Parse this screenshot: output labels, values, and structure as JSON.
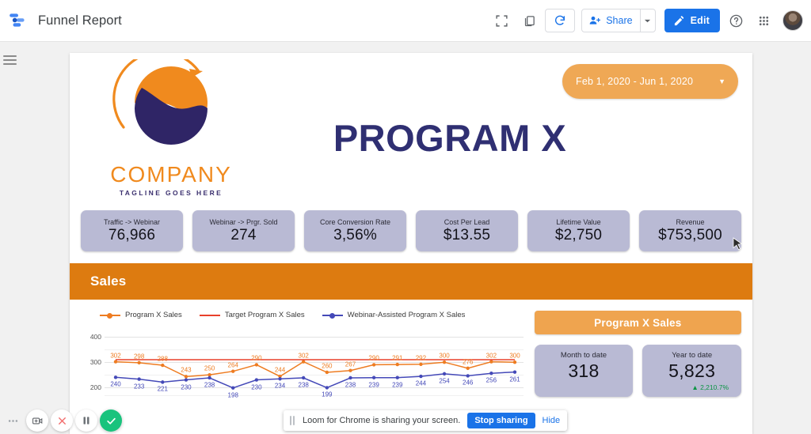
{
  "topbar": {
    "doc_title": "Funnel Report",
    "logo_icon": "data-studio-icon",
    "fullscreen_icon": "fullscreen-icon",
    "copy_icon": "copy-icon",
    "refresh_icon": "refresh-icon",
    "share_label": "Share",
    "share_icon": "person-add-icon",
    "share_caret_icon": "chevron-down-icon",
    "edit_label": "Edit",
    "edit_icon": "pencil-icon",
    "help_icon": "help-circle-icon",
    "apps_icon": "apps-grid-icon",
    "avatar_name": "user-avatar"
  },
  "rail": {
    "menu_icon": "hamburger-menu-icon"
  },
  "report": {
    "logo": {
      "company": "COMPANY",
      "tagline": "TAGLINE GOES HERE",
      "orange": "#F08A1E",
      "navy": "#3a2f6e"
    },
    "title": "PROGRAM X",
    "date_range": {
      "value": "Feb 1, 2020 - Jun 1, 2020",
      "caret_icon": "chevron-down-icon",
      "color": "#EFA855"
    },
    "kpis": [
      {
        "label": "Traffic -> Webinar",
        "value": "76,966"
      },
      {
        "label": "Webinar -> Prgr. Sold",
        "value": "274"
      },
      {
        "label": "Core Conversion Rate",
        "value": "3,56%"
      },
      {
        "label": "Cost Per Lead",
        "value": "$13.55"
      },
      {
        "label": "Lifetime Value",
        "value": "$2,750"
      },
      {
        "label": "Revenue",
        "value": "$753,500"
      }
    ],
    "section_banner": {
      "label": "Sales",
      "color": "#DD7B10"
    },
    "side_panel": {
      "banner": "Program X Sales",
      "scorecards": [
        {
          "label": "Month to date",
          "value": "318",
          "delta": ""
        },
        {
          "label": "Year to date",
          "value": "5,823",
          "delta": "▲ 2,210.7%"
        }
      ]
    }
  },
  "chart_data": {
    "type": "line",
    "title": "",
    "xlabel": "",
    "ylabel": "",
    "ylim": [
      150,
      420
    ],
    "yticks": [
      400,
      300,
      200
    ],
    "grid": true,
    "legend_position": "top",
    "legend": [
      {
        "name": "Program X Sales",
        "color": "#EE7C21",
        "marker": true
      },
      {
        "name": "Target Program X Sales",
        "color": "#E8402B",
        "marker": false
      },
      {
        "name": "Webinar-Assisted Program X Sales",
        "color": "#4449B8",
        "marker": true
      }
    ],
    "series": [
      {
        "name": "Program X Sales",
        "color": "#EE7C21",
        "values": [
          302,
          298,
          288,
          243,
          250,
          264,
          290,
          244,
          302,
          260,
          267,
          290,
          291,
          292,
          300,
          276,
          302,
          300
        ]
      },
      {
        "name": "Target Program X Sales",
        "color": "#E8402B",
        "values": [
          310,
          310,
          310,
          310,
          310,
          310,
          310,
          310,
          310,
          310,
          310,
          310,
          310,
          310,
          310,
          310,
          310,
          310
        ]
      },
      {
        "name": "Webinar-Assisted Program X Sales",
        "color": "#4449B8",
        "values": [
          240,
          233,
          221,
          230,
          238,
          198,
          230,
          234,
          238,
          199,
          238,
          239,
          239,
          244,
          254,
          246,
          256,
          261
        ]
      }
    ]
  },
  "loom": {
    "more_icon": "ellipsis-icon",
    "camera_icon": "camera-icon",
    "cancel_icon": "close-icon",
    "pause_icon": "pause-icon",
    "finish_icon": "check-icon",
    "toast_drag_icon": "drag-handle-icon",
    "toast_text": "Loom for Chrome is sharing your screen.",
    "stop_label": "Stop sharing",
    "hide_label": "Hide"
  }
}
